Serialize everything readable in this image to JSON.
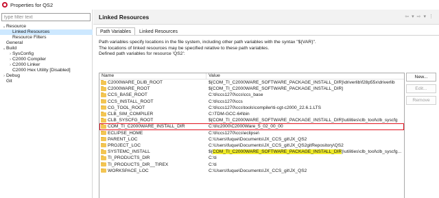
{
  "window": {
    "title": "Properties for QS2"
  },
  "filter": {
    "placeholder": "type filter text"
  },
  "tree": [
    {
      "label": "Resource",
      "twisty": "⌄",
      "level": 0
    },
    {
      "label": "Linked Resources",
      "twisty": "",
      "level": 1,
      "selected": true
    },
    {
      "label": "Resource Filters",
      "twisty": "",
      "level": 1
    },
    {
      "label": "General",
      "twisty": "",
      "level": 0
    },
    {
      "label": "Build",
      "twisty": "⌄",
      "level": 0
    },
    {
      "label": "SysConfig",
      "twisty": "›",
      "level": 1
    },
    {
      "label": "C2000 Compiler",
      "twisty": "›",
      "level": 1
    },
    {
      "label": "C2000 Linker",
      "twisty": "›",
      "level": 1
    },
    {
      "label": "C2000 Hex Utility  [Disabled]",
      "twisty": "",
      "level": 1
    },
    {
      "label": "Debug",
      "twisty": "›",
      "level": 0
    },
    {
      "label": "Git",
      "twisty": "",
      "level": 0
    }
  ],
  "header": {
    "title": "Linked Resources",
    "nav_back": "⇦",
    "nav_back_menu": "▾",
    "nav_fwd": "⇨",
    "nav_fwd_menu": "▾",
    "menu": "⋮"
  },
  "tabs": [
    {
      "label": "Path Variables",
      "active": true
    },
    {
      "label": "Linked Resources",
      "active": false
    }
  ],
  "description": {
    "line1": "Path variables specify locations in the file system, including other path variables with the syntax \"${VAR}\".",
    "line2": "The locations of linked resources may be specified relative to these path variables.",
    "line3": "Defined path variables for resource 'QS2':"
  },
  "table": {
    "columns": {
      "name": "Name",
      "value": "Value"
    },
    "rows": [
      {
        "name": "C2000WARE_DLIB_ROOT",
        "value": "${COM_TI_C2000WARE_SOFTWARE_PACKAGE_INSTALL_DIR}\\driverlib\\f28p55x\\driverlib"
      },
      {
        "name": "C2000WARE_ROOT",
        "value": "${COM_TI_C2000WARE_SOFTWARE_PACKAGE_INSTALL_DIR}"
      },
      {
        "name": "CCS_BASE_ROOT",
        "value": "C:\\ti\\ccs1270\\ccs\\ccs_base"
      },
      {
        "name": "CCS_INSTALL_ROOT",
        "value": "C:\\ti\\ccs1270\\ccs"
      },
      {
        "name": "CG_TOOL_ROOT",
        "value": "C:\\ti\\ccs1270\\ccs\\tools\\compiler\\ti-cgt-c2000_22.6.1.LTS"
      },
      {
        "name": "CLB_SIM_COMPILER",
        "value": "C:\\TDM-GCC-64\\bin"
      },
      {
        "name": "CLB_SYSCFG_ROOT",
        "value": "${COM_TI_C2000WARE_SOFTWARE_PACKAGE_INSTALL_DIR}\\utilities\\clb_tool\\clb_syscfg"
      },
      {
        "name": "COM_TI_C2000WARE_INSTALL_DIR",
        "value": "C:\\ti\\c2000\\C2000Ware_5_02_00_00",
        "boxed": true
      },
      {
        "name": "ECLIPSE_HOME",
        "value": "C:\\ti\\ccs1270\\ccs\\eclipse\\"
      },
      {
        "name": "PARENT_LOC",
        "value": "C:\\Users\\fuque\\Documents\\JX_CCS_git\\JX_QS2"
      },
      {
        "name": "PROJECT_LOC",
        "value": "C:\\Users\\fuque\\Documents\\JX_CCS_git\\JX_QS2gitRepository\\QS2"
      },
      {
        "name": "SYSTEMC_INSTALL",
        "value_prefix": "${",
        "value_hl": "COM_TI_C2000WARE_SOFTWARE_PACKAGE_INSTALL_DIR",
        "value_suffix": "}\\utilities\\clb_tool\\clb_syscfg..."
      },
      {
        "name": "TI_PRODUCTS_DIR",
        "value": "C:\\ti"
      },
      {
        "name": "TI_PRODUCTS_DIR__TIREX",
        "value": "C:\\ti"
      },
      {
        "name": "WORKSPACE_LOC",
        "value": "C:\\Users\\fuque\\Documents\\JX_CCS_git\\JX_QS2"
      }
    ]
  },
  "buttons": {
    "new": "New...",
    "edit": "Edit...",
    "remove": "Remove"
  },
  "colors": {
    "highlight": "#f1ec2a",
    "box": "#e0121e",
    "selection": "#cde8ff"
  }
}
